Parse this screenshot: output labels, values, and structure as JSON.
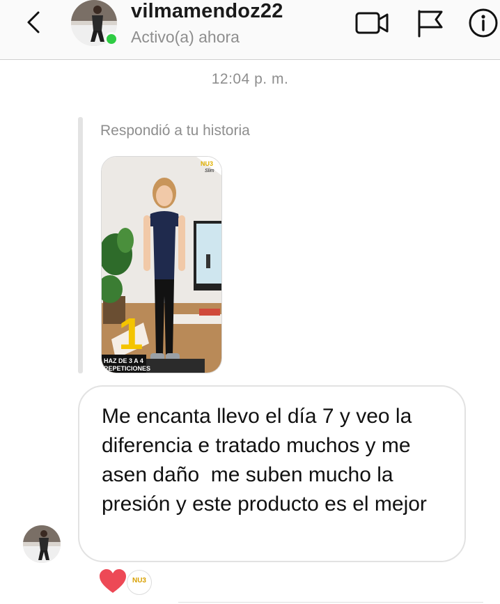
{
  "header": {
    "username": "vilmamendoz22",
    "status": "Activo(a) ahora",
    "icons": [
      "back-chevron-icon",
      "video-call-icon",
      "flag-icon",
      "info-icon"
    ]
  },
  "thread": {
    "timestamp": "12:04 p. m.",
    "story_reply": {
      "label": "Respondió a tu historia",
      "story": {
        "brand_badge": "NU3 Slim",
        "step_number": "1",
        "caption": "HAZ DE 3 A 4 REPETICIONES"
      }
    },
    "message": {
      "text": "Me encanta llevo el día 7 y veo la diferencia e tratado muchos y me asen daño  me suben mucho la presión y este producto es el mejor"
    },
    "reactions": [
      {
        "type": "heart",
        "color": "#ed4956"
      },
      {
        "type": "brand",
        "label": "NU3"
      }
    ]
  },
  "colors": {
    "online": "#2fcc44",
    "secondary_text": "#8e8e8e",
    "heart": "#ed4956"
  }
}
